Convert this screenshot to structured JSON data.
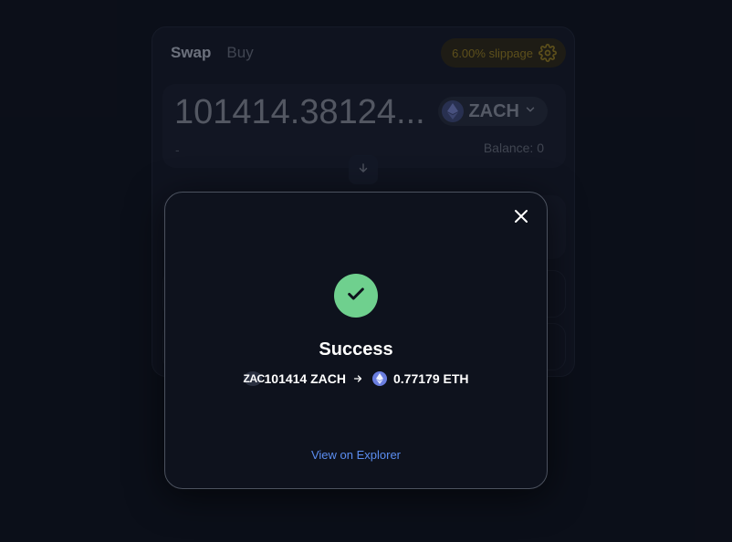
{
  "swap_widget": {
    "tabs": [
      "Swap",
      "Buy"
    ],
    "slippage_label": "6.00% slippage",
    "input": {
      "amount": "101414.38124...",
      "token_symbol": "ZACH",
      "usd_value": "-",
      "balance": "Balance: 0"
    }
  },
  "modal": {
    "title": "Success",
    "from": {
      "logo_text": "ZAC",
      "amount": "101414 ZACH"
    },
    "to": {
      "amount": "0.77179 ETH"
    },
    "explorer_link": "View on Explorer"
  },
  "colors": {
    "background": "#0d111c",
    "success_green": "#6fd08e",
    "link_blue": "#5b8df0",
    "slippage_warning": "#8a7420"
  },
  "icons": [
    "gear-icon",
    "eth-icon",
    "chevron-down-icon",
    "arrow-down-icon",
    "close-icon",
    "check-icon",
    "arrow-right-icon"
  ]
}
